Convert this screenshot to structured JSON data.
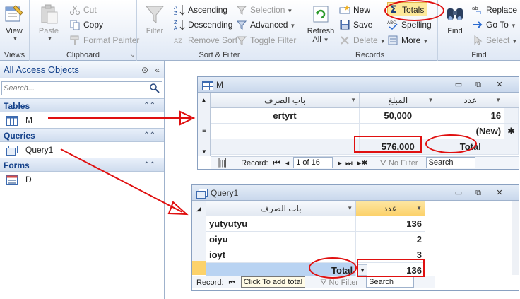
{
  "ribbon": {
    "views": {
      "view_label": "View",
      "group_title": "Views"
    },
    "clipboard": {
      "paste_label": "Paste",
      "cut_label": "Cut",
      "copy_label": "Copy",
      "format_painter_label": "Format Painter",
      "group_title": "Clipboard"
    },
    "sort_filter": {
      "filter_label": "Filter",
      "ascending_label": "Ascending",
      "descending_label": "Descending",
      "remove_sort_label": "Remove Sort",
      "selection_label": "Selection",
      "advanced_label": "Advanced",
      "toggle_filter_label": "Toggle Filter",
      "group_title": "Sort & Filter"
    },
    "records": {
      "refresh_label": "Refresh",
      "refresh_all_label": "All",
      "new_label": "New",
      "save_label": "Save",
      "delete_label": "Delete",
      "totals_label": "Totals",
      "spelling_label": "Spelling",
      "more_label": "More",
      "group_title": "Records"
    },
    "find": {
      "find_label": "Find",
      "replace_label": "Replace",
      "goto_label": "Go To",
      "select_label": "Select",
      "group_title": "Find"
    }
  },
  "nav": {
    "title": "All Access Objects",
    "search_placeholder": "Search...",
    "categories": [
      {
        "label": "Tables",
        "items": [
          "M"
        ]
      },
      {
        "label": "Queries",
        "items": [
          "Query1"
        ]
      },
      {
        "label": "Forms",
        "items": [
          "D"
        ]
      }
    ]
  },
  "table_m": {
    "title": "M",
    "columns": [
      "باب الصرف",
      "المبلغ",
      "عدد"
    ],
    "rows": [
      {
        "bab": "ertyrt",
        "amount": "50,000",
        "count": "16"
      },
      {
        "bab": "",
        "amount": "",
        "count": "(New)"
      }
    ],
    "total_amount": "576,000",
    "total_label": "Total",
    "record_nav": {
      "label": "Record:",
      "position": "1 of 16",
      "filter_label": "No Filter",
      "search_label": "Search"
    }
  },
  "query1": {
    "title": "Query1",
    "columns": [
      "باب الصرف",
      "عدد"
    ],
    "rows": [
      {
        "bab": "yutyutyu",
        "count": "136"
      },
      {
        "bab": "oiyu",
        "count": "2"
      },
      {
        "bab": "ioyt",
        "count": "3"
      }
    ],
    "total_label": "Total",
    "total_value": "136",
    "record_nav": {
      "label": "Record:",
      "tooltip": "Click To add total",
      "filter_label": "No Filter",
      "search_label": "Search"
    }
  },
  "colors": {
    "annotation_red": "#e01010",
    "totals_highlight": "#fde99a",
    "query_count_header": "#fcd26b"
  }
}
